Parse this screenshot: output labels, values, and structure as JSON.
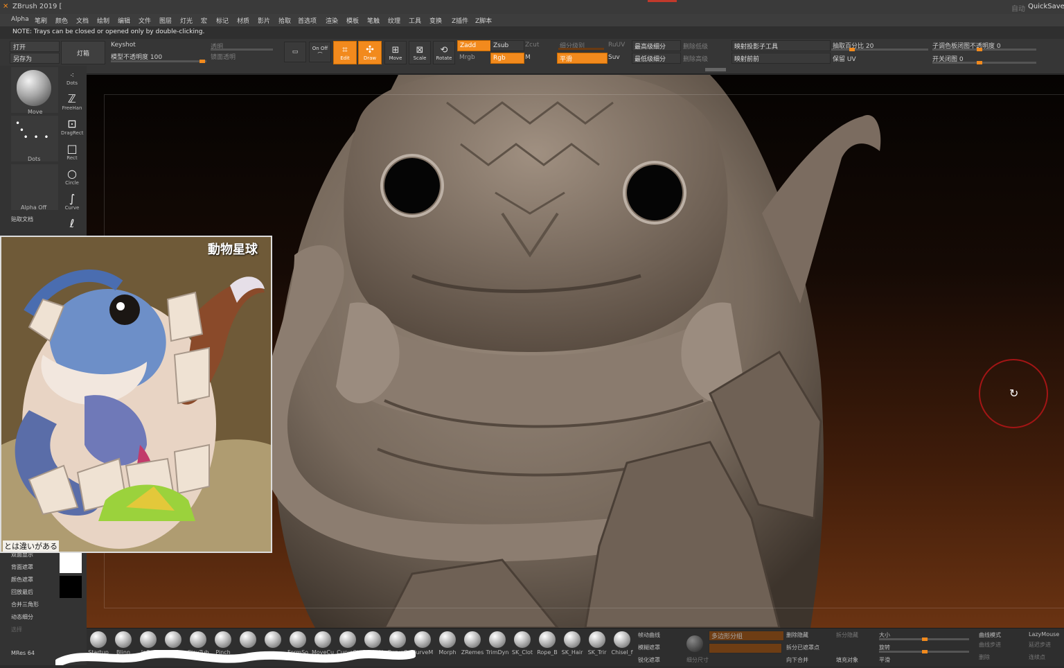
{
  "titlebar": {
    "app_title": "ZBrush 2019 [",
    "right_label_dim": "自动",
    "quicksave": "QuickSave"
  },
  "menu": [
    "Alpha",
    "笔刷",
    "颜色",
    "文档",
    "绘制",
    "编辑",
    "文件",
    "图层",
    "灯光",
    "宏",
    "标记",
    "材质",
    "影片",
    "拾取",
    "首选项",
    "渲染",
    "模板",
    "笔触",
    "纹理",
    "工具",
    "变换",
    "Z插件",
    "Z脚本"
  ],
  "note": "NOTE: Trays can be closed or opened only by double-clicking.",
  "toolbar": {
    "open": "打开",
    "save_as": "另存为",
    "light_box": "灯箱",
    "keyshot": "Keyshot",
    "model_opacity": "模型不透明度 100",
    "transp_dim": "透明",
    "gradient_dim": "镜面透明",
    "onoff": "On Off",
    "edit": "Edit",
    "draw": "Draw",
    "move": "Move",
    "scale": "Scale",
    "rotate": "Rotate",
    "zadd": "Zadd",
    "zsub": "Zsub",
    "zcut": "Zcut",
    "mrgb": "Mrgb",
    "rgb": "Rgb",
    "m": "M",
    "subdiv_dim": "细分级别",
    "smooth": "平滑",
    "ruv_dim": "RuUV",
    "suv": "Suv",
    "high_subdiv": "最高级细分",
    "low_subdiv": "最低级细分",
    "del_higher_dim": "删除低级",
    "del_lower_dim": "删除高级",
    "project_subtool": "映射投影子工具",
    "project_prev": "映射前前",
    "extract_pct": "抽取百分比 20",
    "keep_uv": "保留 UV",
    "subtool_color": "子调色板闭图不透明度 0",
    "toggle_close": "开关闭图 0"
  },
  "leftpanel": {
    "brush_name": "Move",
    "stroke_name": "Dots",
    "alpha_name": "Alpha Off",
    "texture_label": "贴取文档",
    "tools": [
      "Dots",
      "FreeHan",
      "DragRect",
      "Rect",
      "Circle",
      "Curve",
      "Lasso"
    ],
    "lower_items": [
      "双面显示",
      "背面遮罩",
      "颜色遮罩",
      "回放最后",
      "合并三角形",
      "动态细分",
      "选择"
    ],
    "mres": "MRes 64"
  },
  "reference": {
    "watermark": "動物星球",
    "caption": "とは違いがある"
  },
  "brushes": [
    "Startup",
    "Blinn",
    "Inflat",
    "Standar",
    "ClayTub",
    "Pinch",
    "",
    "",
    "FormSo",
    "MoveCu",
    "CurveSt",
    "SnakeH",
    "CurveQ",
    "CurveM",
    "Morph",
    "ZRemes",
    "TrimDyn",
    "SK_Clot",
    "Rope_B",
    "SK_Hair",
    "SK_Trir",
    "Chisel_f"
  ],
  "bottom": {
    "right_items": [
      "帧动曲线",
      "模糊遮罩",
      "锐化遮罩",
      "多边形分组",
      "细分尺寸",
      "删除隐藏",
      "拆分已遮罩点",
      "向下合并",
      "拆分隐藏",
      "填充对象",
      "大小",
      "旋转",
      "平滑",
      "曲线模式",
      "曲线步进",
      "删除",
      "LazyMouse",
      "延迟步进",
      "连续点"
    ]
  },
  "colors": {
    "accent": "#f28a1d",
    "panel": "#333333",
    "model": "#7a6b5e"
  }
}
